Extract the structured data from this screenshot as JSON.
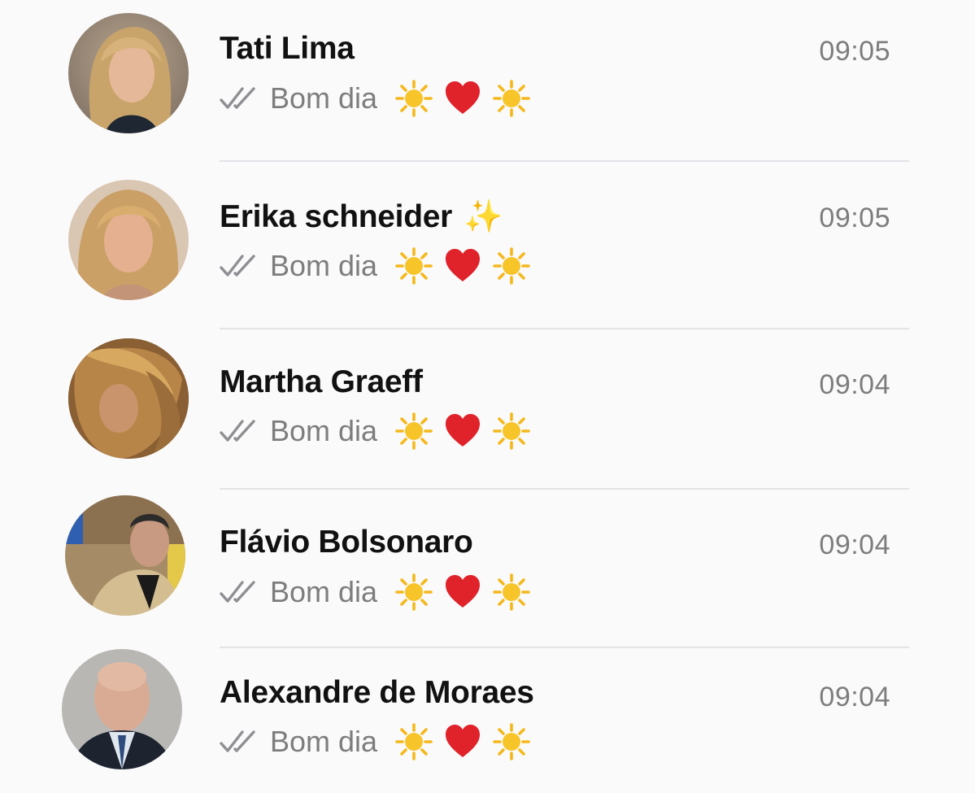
{
  "chats": [
    {
      "name": "Tati Lima",
      "name_emoji": "",
      "time": "09:05",
      "message": "Bom dia",
      "message_emojis": [
        "sun",
        "red-heart",
        "sun"
      ],
      "status": "read-double-check",
      "avatar_icon": "woman-blonde-avatar"
    },
    {
      "name": "Erika schneider",
      "name_emoji": "✨",
      "time": "09:05",
      "message": "Bom dia",
      "message_emojis": [
        "sun",
        "red-heart",
        "sun"
      ],
      "status": "read-double-check",
      "avatar_icon": "woman-blonde-avatar"
    },
    {
      "name": "Martha Graeff",
      "name_emoji": "",
      "time": "09:04",
      "message": "Bom dia",
      "message_emojis": [
        "sun",
        "red-heart",
        "sun"
      ],
      "status": "read-double-check",
      "avatar_icon": "woman-hair-avatar"
    },
    {
      "name": "Flávio Bolsonaro",
      "name_emoji": "",
      "time": "09:04",
      "message": "Bom dia",
      "message_emojis": [
        "sun",
        "red-heart",
        "sun"
      ],
      "status": "read-double-check",
      "avatar_icon": "man-tan-jacket-avatar"
    },
    {
      "name": "Alexandre de Moraes",
      "name_emoji": "",
      "time": "09:04",
      "message": "Bom dia",
      "message_emojis": [
        "sun",
        "red-heart",
        "sun"
      ],
      "status": "read-double-check",
      "avatar_icon": "man-bald-suit-avatar"
    }
  ],
  "colors": {
    "background": "#fafafa",
    "name_text": "#111111",
    "secondary_text": "#7d7d7d",
    "divider": "#e3e3e8",
    "heart": "#e0222a",
    "sun": "#f5b81c"
  }
}
